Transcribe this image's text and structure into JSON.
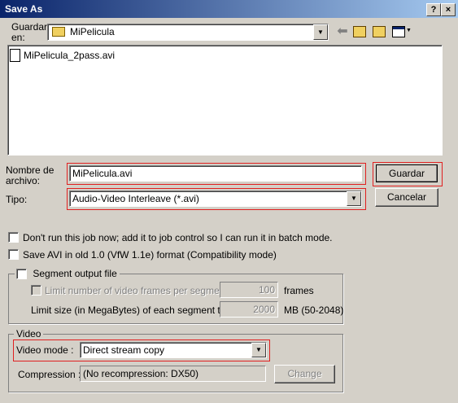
{
  "window": {
    "title": "Save As",
    "help_icon": "?",
    "close_icon": "×"
  },
  "save_in": {
    "label": "Guardar en:",
    "value": "MiPelicula"
  },
  "toolbar": {
    "icons": [
      "back-arrow-icon",
      "up-folder-icon",
      "new-folder-icon",
      "view-menu-icon"
    ]
  },
  "files": [
    {
      "name": "MiPelicula_2pass.avi",
      "icon": "avi-file-icon"
    }
  ],
  "filename": {
    "label": "Nombre de archivo:",
    "value": "MiPelicula.avi"
  },
  "filetype": {
    "label": "Tipo:",
    "value": "Audio-Video Interleave (*.avi)"
  },
  "buttons": {
    "save": "Guardar",
    "cancel": "Cancelar"
  },
  "options": {
    "job_control": "Don't run this job now; add it to job control so I can run it in batch mode.",
    "old_avi": "Save AVI in old 1.0 (VfW 1.1e) format (Compatibility mode)"
  },
  "segment": {
    "title": "Segment output file",
    "limit_frames_label": "Limit number of video frames per segment to",
    "frames_value": "100",
    "frames_unit": "frames",
    "limit_size_label": "Limit size (in MegaBytes) of each segment to :",
    "size_value": "2000",
    "size_unit": "MB (50-2048)"
  },
  "video": {
    "title": "Video",
    "mode_label": "Video mode :",
    "mode_value": "Direct stream copy",
    "compression_label": "Compression :",
    "compression_value": "(No recompression: DX50)",
    "change_button": "Change"
  }
}
